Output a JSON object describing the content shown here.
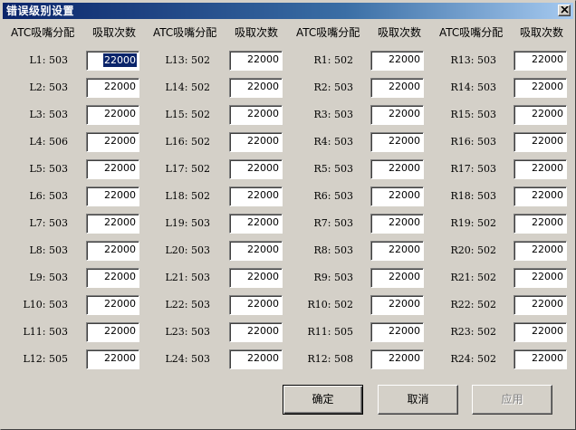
{
  "window": {
    "title": "错误级别设置"
  },
  "columns": [
    {
      "label_header": "ATC吸嘴分配",
      "value_header": "吸取次数",
      "rows": [
        {
          "label": "L1: 503",
          "value": "22000"
        },
        {
          "label": "L2: 503",
          "value": "22000"
        },
        {
          "label": "L3: 503",
          "value": "22000"
        },
        {
          "label": "L4: 506",
          "value": "22000"
        },
        {
          "label": "L5: 503",
          "value": "22000"
        },
        {
          "label": "L6: 503",
          "value": "22000"
        },
        {
          "label": "L7: 503",
          "value": "22000"
        },
        {
          "label": "L8: 503",
          "value": "22000"
        },
        {
          "label": "L9: 503",
          "value": "22000"
        },
        {
          "label": "L10: 503",
          "value": "22000"
        },
        {
          "label": "L11: 503",
          "value": "22000"
        },
        {
          "label": "L12: 505",
          "value": "22000"
        }
      ]
    },
    {
      "label_header": "ATC吸嘴分配",
      "value_header": "吸取次数",
      "rows": [
        {
          "label": "L13: 502",
          "value": "22000"
        },
        {
          "label": "L14: 502",
          "value": "22000"
        },
        {
          "label": "L15: 502",
          "value": "22000"
        },
        {
          "label": "L16: 502",
          "value": "22000"
        },
        {
          "label": "L17: 502",
          "value": "22000"
        },
        {
          "label": "L18: 502",
          "value": "22000"
        },
        {
          "label": "L19: 503",
          "value": "22000"
        },
        {
          "label": "L20: 503",
          "value": "22000"
        },
        {
          "label": "L21: 503",
          "value": "22000"
        },
        {
          "label": "L22: 503",
          "value": "22000"
        },
        {
          "label": "L23: 503",
          "value": "22000"
        },
        {
          "label": "L24: 503",
          "value": "22000"
        }
      ]
    },
    {
      "label_header": "ATC吸嘴分配",
      "value_header": "吸取次数",
      "rows": [
        {
          "label": "R1: 502",
          "value": "22000"
        },
        {
          "label": "R2: 503",
          "value": "22000"
        },
        {
          "label": "R3: 503",
          "value": "22000"
        },
        {
          "label": "R4: 503",
          "value": "22000"
        },
        {
          "label": "R5: 503",
          "value": "22000"
        },
        {
          "label": "R6: 503",
          "value": "22000"
        },
        {
          "label": "R7: 503",
          "value": "22000"
        },
        {
          "label": "R8: 503",
          "value": "22000"
        },
        {
          "label": "R9: 503",
          "value": "22000"
        },
        {
          "label": "R10: 502",
          "value": "22000"
        },
        {
          "label": "R11: 505",
          "value": "22000"
        },
        {
          "label": "R12: 508",
          "value": "22000"
        }
      ]
    },
    {
      "label_header": "ATC吸嘴分配",
      "value_header": "吸取次数",
      "rows": [
        {
          "label": "R13: 503",
          "value": "22000"
        },
        {
          "label": "R14: 503",
          "value": "22000"
        },
        {
          "label": "R15: 503",
          "value": "22000"
        },
        {
          "label": "R16: 503",
          "value": "22000"
        },
        {
          "label": "R17: 503",
          "value": "22000"
        },
        {
          "label": "R18: 503",
          "value": "22000"
        },
        {
          "label": "R19: 502",
          "value": "22000"
        },
        {
          "label": "R20: 502",
          "value": "22000"
        },
        {
          "label": "R21: 502",
          "value": "22000"
        },
        {
          "label": "R22: 502",
          "value": "22000"
        },
        {
          "label": "R23: 502",
          "value": "22000"
        },
        {
          "label": "R24: 502",
          "value": "22000"
        }
      ]
    }
  ],
  "buttons": {
    "ok": "确定",
    "cancel": "取消",
    "apply": "应用"
  },
  "state": {
    "selected_field": "L1",
    "apply_enabled": false
  },
  "colors": {
    "face": "#d4d0c8",
    "title_start": "#0a246a",
    "title_end": "#a6caf0",
    "selection": "#0a246a"
  }
}
